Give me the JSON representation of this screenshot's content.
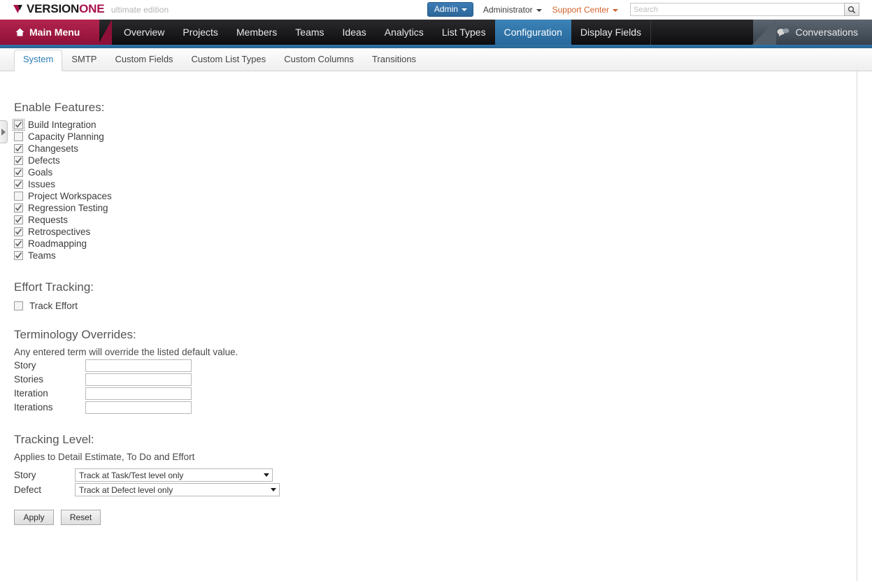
{
  "brand": {
    "name_part1": "VERSION",
    "name_part2": "ONE",
    "edition": "ultimate edition",
    "mark_icon": "versionone-arrow-icon",
    "accent_color": "#a8114b"
  },
  "header": {
    "admin_button": "Admin",
    "user_menu": "Administrator",
    "support_menu": "Support Center",
    "search_placeholder": "Search",
    "search_value": "",
    "search_icon": "search-icon",
    "admin_button_color": "#2e6da4",
    "support_color": "#d2622a"
  },
  "mainnav": {
    "main_menu": "Main Menu",
    "home_icon": "home-icon",
    "items": [
      {
        "label": "Overview",
        "active": false
      },
      {
        "label": "Projects",
        "active": false
      },
      {
        "label": "Members",
        "active": false
      },
      {
        "label": "Teams",
        "active": false
      },
      {
        "label": "Ideas",
        "active": false
      },
      {
        "label": "Analytics",
        "active": false
      },
      {
        "label": "List Types",
        "active": false
      },
      {
        "label": "Configuration",
        "active": true
      },
      {
        "label": "Display Fields",
        "active": false
      }
    ],
    "conversations": "Conversations",
    "conversations_icon": "speech-bubbles-icon",
    "active_color": "#2f79ad",
    "main_menu_color": "#a8214a"
  },
  "subtabs": {
    "items": [
      {
        "label": "System",
        "active": true
      },
      {
        "label": "SMTP",
        "active": false
      },
      {
        "label": "Custom Fields",
        "active": false
      },
      {
        "label": "Custom List Types",
        "active": false
      },
      {
        "label": "Custom Columns",
        "active": false
      },
      {
        "label": "Transitions",
        "active": false
      }
    ],
    "active_color": "#2d7cb5"
  },
  "sidebar_handle": {
    "icon": "chevron-right-icon"
  },
  "enable_features": {
    "title": "Enable Features:",
    "items": [
      {
        "label": "Build Integration",
        "checked": true,
        "focused": true
      },
      {
        "label": "Capacity Planning",
        "checked": false,
        "focused": false
      },
      {
        "label": "Changesets",
        "checked": true,
        "focused": false
      },
      {
        "label": "Defects",
        "checked": true,
        "focused": false
      },
      {
        "label": "Goals",
        "checked": true,
        "focused": false
      },
      {
        "label": "Issues",
        "checked": true,
        "focused": false
      },
      {
        "label": "Project Workspaces",
        "checked": false,
        "focused": false
      },
      {
        "label": "Regression Testing",
        "checked": true,
        "focused": false
      },
      {
        "label": "Requests",
        "checked": true,
        "focused": false
      },
      {
        "label": "Retrospectives",
        "checked": true,
        "focused": false
      },
      {
        "label": "Roadmapping",
        "checked": true,
        "focused": false
      },
      {
        "label": "Teams",
        "checked": true,
        "focused": false
      }
    ]
  },
  "effort_tracking": {
    "title": "Effort Tracking:",
    "checkbox_label": "Track Effort",
    "checked": false
  },
  "terminology_overrides": {
    "title": "Terminology Overrides:",
    "hint": "Any entered term will override the listed default value.",
    "fields": [
      {
        "label": "Story",
        "value": ""
      },
      {
        "label": "Stories",
        "value": ""
      },
      {
        "label": "Iteration",
        "value": ""
      },
      {
        "label": "Iterations",
        "value": ""
      }
    ]
  },
  "tracking_level": {
    "title": "Tracking Level:",
    "hint": "Applies to Detail Estimate, To Do and Effort",
    "rows": [
      {
        "label": "Story",
        "value": "Track at Task/Test level only"
      },
      {
        "label": "Defect",
        "value": "Track at Defect level only"
      }
    ]
  },
  "actions": {
    "apply": "Apply",
    "reset": "Reset"
  }
}
